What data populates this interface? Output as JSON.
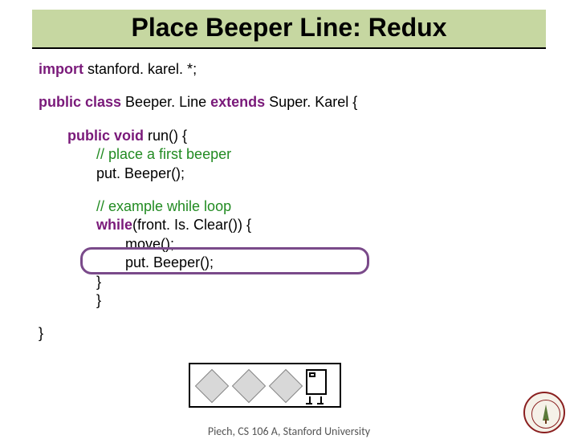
{
  "title": "Place Beeper Line: Redux",
  "code": {
    "import_kw": "import",
    "import_rest": " stanford. karel. *;",
    "class_kw1": "public class",
    "class_mid": " Beeper. Line ",
    "class_kw2": "extends",
    "class_rest": " Super. Karel {",
    "run_kw": "public void",
    "run_rest": " run() {",
    "cm1": "// place a first beeper",
    "put1": "put. Beeper();",
    "cm2": "// example while loop",
    "while_kw": "while",
    "while_rest": "(front. Is. Clear()) {",
    "move": "move();",
    "put2": "put. Beeper();",
    "close1": "}",
    "close2": "}",
    "close3": "}"
  },
  "footer": "Piech, CS 106 A, Stanford University"
}
